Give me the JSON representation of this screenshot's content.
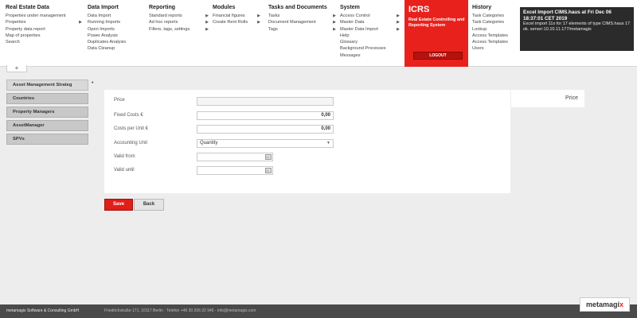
{
  "menu": {
    "columns": [
      {
        "title": "Real Estate Data",
        "items": [
          {
            "label": "Properties under management",
            "arrow": false
          },
          {
            "label": "Properties",
            "arrow": true
          },
          {
            "label": "Property data report",
            "arrow": false
          },
          {
            "label": "Map of properties",
            "arrow": false
          },
          {
            "label": "Search",
            "arrow": false
          }
        ]
      },
      {
        "title": "Data Import",
        "items": [
          {
            "label": "Data Import",
            "arrow": false
          },
          {
            "label": "Running Imports",
            "arrow": false
          },
          {
            "label": "Open Imports",
            "arrow": false
          },
          {
            "label": "Power Analysis",
            "arrow": false
          },
          {
            "label": "Duplicates Analysis",
            "arrow": false
          },
          {
            "label": "Data Cleanup",
            "arrow": false
          }
        ]
      },
      {
        "title": "Reporting",
        "items": [
          {
            "label": "Standard reports",
            "arrow": true
          },
          {
            "label": "Ad hoc reports",
            "arrow": true
          },
          {
            "label": "Filters, tags, settings",
            "arrow": true
          }
        ]
      },
      {
        "title": "Modules",
        "items": [
          {
            "label": "Financial figures",
            "arrow": true
          },
          {
            "label": "Create Rent Rolls",
            "arrow": true
          }
        ]
      },
      {
        "title": "Tasks and Documents",
        "items": [
          {
            "label": "Tasks",
            "arrow": true
          },
          {
            "label": "Document Management",
            "arrow": true
          },
          {
            "label": "Tags",
            "arrow": true
          }
        ]
      },
      {
        "title": "System",
        "items": [
          {
            "label": "Access Control",
            "arrow": true
          },
          {
            "label": "Master Data",
            "arrow": true
          },
          {
            "label": "Master Data Import",
            "arrow": true
          },
          {
            "label": "Help",
            "arrow": false
          },
          {
            "label": "Glossary",
            "arrow": false
          },
          {
            "label": "Background Processes",
            "arrow": false
          },
          {
            "label": "Messages",
            "arrow": false
          }
        ]
      },
      {
        "title": "History",
        "items": [
          {
            "label": "Task Categories",
            "arrow": false
          },
          {
            "label": "Task Categories",
            "arrow": false
          },
          {
            "label": "Lookup",
            "arrow": false
          },
          {
            "label": "Access Templates",
            "arrow": false
          },
          {
            "label": "Access Templates",
            "arrow": false
          },
          {
            "label": "Users",
            "arrow": false
          }
        ]
      }
    ]
  },
  "brand": {
    "name": "ICRS",
    "subtitle": "Real Estate Controlling and Reporting System",
    "logout_label": "LOGOUT",
    "color": "#e8211c"
  },
  "notification": {
    "title": "Excel Import CIMS.haus at Fri Dec 06 18:37:01 CET 2019",
    "body": "Excel import 11s for 17 elements of type CIMS.haus 17 ok. server:10.10.11.177/metamagix"
  },
  "tab_add_label": "+",
  "sidebar": {
    "items": [
      {
        "label": "Asset Management Strateg",
        "active": true
      },
      {
        "label": "Countries",
        "active": false
      },
      {
        "label": "Property Managers",
        "active": false
      },
      {
        "label": "AssetManager",
        "active": false
      },
      {
        "label": "SPVs",
        "active": false
      }
    ],
    "active_marker": "•"
  },
  "form": {
    "title": "Price",
    "fields": {
      "price": {
        "label": "Price",
        "value": ""
      },
      "fixed_costs": {
        "label": "Fixed Costs €",
        "value": "0,00"
      },
      "costs_per_unit": {
        "label": "Costs per Unit €",
        "value": "0,00"
      },
      "accounting_unit": {
        "label": "Accounting Unit",
        "value": "Quantity"
      },
      "valid_from": {
        "label": "Valid from",
        "value": ""
      },
      "valid_until": {
        "label": "Valid until",
        "value": ""
      }
    }
  },
  "buttons": {
    "save": "Save",
    "back": "Back"
  },
  "footer": {
    "company": "metamagix Software & Consulting GmbH",
    "contact": "Friedrichstraße 171, 10117 Berlin · Telefon +49 30 206 22 945 · info@metamagix.com"
  },
  "logo": {
    "text": "metamagi",
    "accent": "x"
  }
}
